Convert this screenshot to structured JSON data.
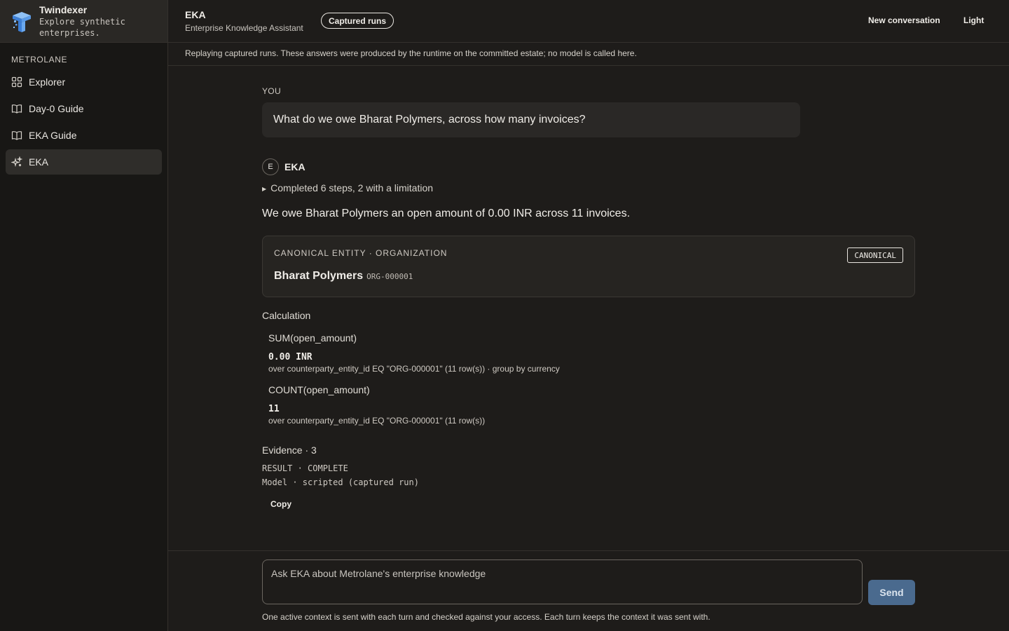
{
  "brand": {
    "title": "Twindexer",
    "subtitle": "Explore synthetic enterprises."
  },
  "sidebar": {
    "section_label": "METROLANE",
    "items": [
      {
        "label": "Explorer",
        "icon": "grid-icon",
        "active": false
      },
      {
        "label": "Day-0 Guide",
        "icon": "book-icon",
        "active": false
      },
      {
        "label": "EKA Guide",
        "icon": "book-icon",
        "active": false
      },
      {
        "label": "EKA",
        "icon": "sparkle-icon",
        "active": true
      }
    ]
  },
  "header": {
    "title": "EKA",
    "subtitle": "Enterprise Knowledge Assistant",
    "badge": "Captured runs",
    "new_conversation": "New conversation",
    "theme_toggle": "Light"
  },
  "banner": "Replaying captured runs. These answers were produced by the runtime on the committed estate; no model is called here.",
  "conversation": {
    "user_label": "YOU",
    "user_message": "What do we owe Bharat Polymers, across how many invoices?",
    "assistant_avatar": "E",
    "assistant_name": "EKA",
    "steps_summary": "Completed 6 steps, 2 with a limitation",
    "answer": "We owe Bharat Polymers an open amount of 0.00 INR across 11 invoices.",
    "entity": {
      "kind": "CANONICAL ENTITY · ORGANIZATION",
      "name": "Bharat Polymers",
      "id": "ORG-000001",
      "badge": "CANONICAL"
    },
    "calculation_title": "Calculation",
    "calculations": [
      {
        "fn": "SUM(open_amount)",
        "value": "0.00 INR",
        "over": "over counterparty_entity_id EQ \"ORG-000001\" (11 row(s)) · group by currency"
      },
      {
        "fn": "COUNT(open_amount)",
        "value": "11",
        "over": "over counterparty_entity_id EQ \"ORG-000001\" (11 row(s))"
      }
    ],
    "evidence": "Evidence · 3",
    "result_meta": "RESULT · COMPLETE",
    "model_meta": "Model · scripted (captured run)",
    "copy_label": "Copy"
  },
  "composer": {
    "placeholder": "Ask EKA about Metrolane's enterprise knowledge",
    "value": "",
    "send_label": "Send",
    "footnote": "One active context is sent with each turn and checked against your access. Each turn keeps the context it was sent with."
  },
  "colors": {
    "background": "#1e1c1a",
    "sidebar": "#181715",
    "send_button": "#4a6a8e",
    "logo_blue": "#5a9be8"
  }
}
